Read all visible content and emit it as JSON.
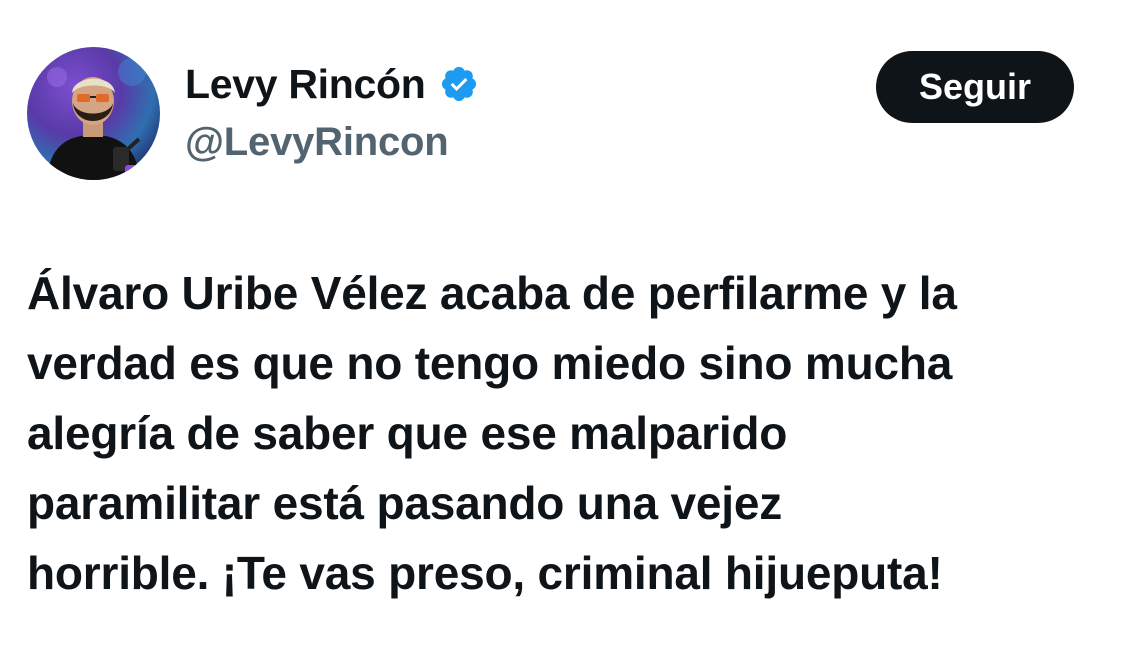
{
  "author": {
    "display_name": "Levy Rincón",
    "handle": "@LevyRincon",
    "verified_icon": "verified-badge-icon",
    "avatar_icon": "profile-avatar"
  },
  "actions": {
    "follow_label": "Seguir"
  },
  "tweet": {
    "lines": [
      "Álvaro Uribe Vélez acaba de perfilarme y la",
      "verdad es que no tengo miedo sino mucha",
      "alegría de saber que ese malparido",
      "paramilitar está pasando una vejez",
      "horrible. ¡Te vas preso, criminal hijueputa!"
    ]
  },
  "colors": {
    "text_primary": "#0f1419",
    "text_secondary": "#536471",
    "verified_blue": "#1d9bf0",
    "button_bg": "#0f1419",
    "button_text": "#ffffff",
    "background": "#ffffff"
  }
}
